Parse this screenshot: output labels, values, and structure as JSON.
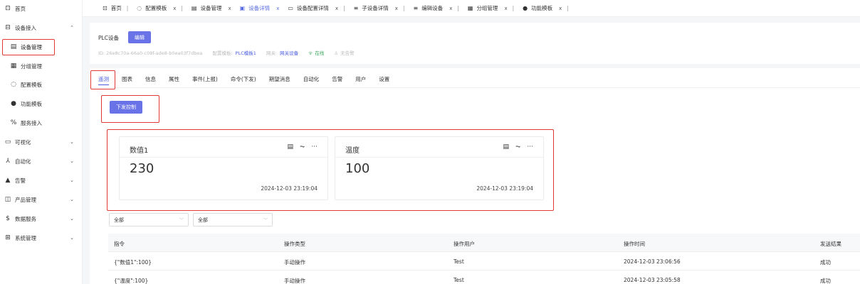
{
  "sidebar": {
    "items": [
      {
        "label": "首页",
        "icon": "home-icon",
        "glyph": "⊡",
        "chevron": ""
      },
      {
        "label": "设备接入",
        "icon": "monitor-icon",
        "glyph": "⊟",
        "chevron": "⌃"
      },
      {
        "label": "设备管理",
        "icon": "device-icon",
        "glyph": "▤",
        "chevron": ""
      },
      {
        "label": "分组管理",
        "icon": "grid-icon",
        "glyph": "▦",
        "chevron": ""
      },
      {
        "label": "配置模板",
        "icon": "template-icon",
        "glyph": "◌",
        "chevron": ""
      },
      {
        "label": "功能模板",
        "icon": "function-icon",
        "glyph": "●",
        "chevron": ""
      },
      {
        "label": "服务接入",
        "icon": "service-icon",
        "glyph": "%",
        "chevron": ""
      },
      {
        "label": "可视化",
        "icon": "visual-icon",
        "glyph": "▭",
        "chevron": "⌄"
      },
      {
        "label": "自动化",
        "icon": "automation-icon",
        "glyph": "⅄",
        "chevron": "⌄"
      },
      {
        "label": "告警",
        "icon": "alert-icon",
        "glyph": "▲",
        "chevron": "⌄"
      },
      {
        "label": "产品管理",
        "icon": "product-icon",
        "glyph": "◫",
        "chevron": "⌄"
      },
      {
        "label": "数据服务",
        "icon": "data-icon",
        "glyph": "$",
        "chevron": "⌄"
      },
      {
        "label": "系统管理",
        "icon": "system-icon",
        "glyph": "⊞",
        "chevron": "⌄"
      }
    ]
  },
  "tabs": [
    {
      "label": "首页",
      "icon": "home-icon",
      "glyph": "⊡",
      "closable": false
    },
    {
      "label": "配置模板",
      "icon": "template-icon",
      "glyph": "◌",
      "closable": true
    },
    {
      "label": "设备管理",
      "icon": "device-icon",
      "glyph": "▤",
      "closable": true
    },
    {
      "label": "设备详情",
      "icon": "detail-icon",
      "glyph": "▣",
      "closable": true
    },
    {
      "label": "设备配置详情",
      "icon": "config-icon",
      "glyph": "▭",
      "closable": true
    },
    {
      "label": "子设备详情",
      "icon": "list-icon",
      "glyph": "≡",
      "closable": true
    },
    {
      "label": "编辑设备",
      "icon": "list-icon",
      "glyph": "≡",
      "closable": true
    },
    {
      "label": "分组管理",
      "icon": "grid-icon",
      "glyph": "▦",
      "closable": true
    },
    {
      "label": "功能模板",
      "icon": "function-icon",
      "glyph": "●",
      "closable": true
    }
  ],
  "device": {
    "name": "PLC设备",
    "edit_label": "编辑",
    "id_text": "ID: 26e8c70a-66a0-c08f-ade8-b0ea03f7dbea",
    "config_label": "配置模板:",
    "config_value": "PLC模板1",
    "gateway_label": "网关:",
    "gateway_value": "网关设备",
    "status": "在线",
    "alarm": "无告警"
  },
  "subtabs": [
    "遥测",
    "图表",
    "信息",
    "属性",
    "事件(上报)",
    "命令(下发)",
    "期望消息",
    "自动化",
    "告警",
    "用户",
    "设置"
  ],
  "send_control_label": "下发控制",
  "telemetry": [
    {
      "title": "数值1",
      "value": "230",
      "time": "2024-12-03 23:19:04"
    },
    {
      "title": "温度",
      "value": "100",
      "time": "2024-12-03 23:19:04"
    }
  ],
  "tool_icons": [
    "document-icon",
    "chart-icon",
    "more-icon"
  ],
  "filters": [
    "全部",
    "全部"
  ],
  "table": {
    "headers": [
      "指令",
      "操作类型",
      "操作用户",
      "操作时间",
      "发送结果"
    ],
    "rows": [
      [
        "{\"数值1\":100}",
        "手动操作",
        "Test",
        "2024-12-03 23:06:56",
        "成功"
      ],
      [
        "{\"温度\":100}",
        "手动操作",
        "Test",
        "2024-12-03 23:05:58",
        "成功"
      ]
    ]
  },
  "colors": {
    "accent": "#6a72e8",
    "link": "#4a5de0",
    "online": "#3aa55a",
    "highlight": "#e53935"
  }
}
